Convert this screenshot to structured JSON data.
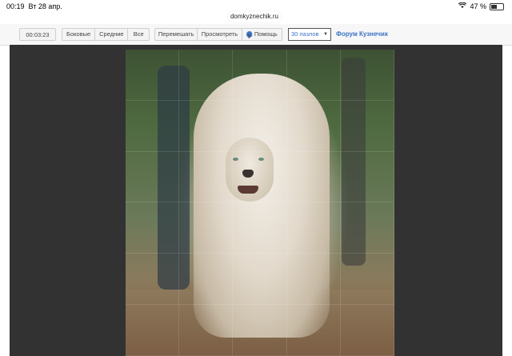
{
  "status_bar": {
    "time": "00:19",
    "date": "Вт 28 апр.",
    "battery_percent": "47 %",
    "battery_level": 0.47
  },
  "browser": {
    "url": "domkyznechik.ru"
  },
  "toolbar": {
    "timer": "00:03:23",
    "edge_buttons": [
      "Боковые",
      "Средние",
      "Все"
    ],
    "action_buttons": {
      "shuffle": "Перемешать",
      "preview": "Просмотреть",
      "help": "Помощь"
    },
    "pieces_select": {
      "value": "30 пазлов"
    },
    "forum_link": "Форум Кузнечик"
  },
  "puzzle": {
    "rows": 6,
    "cols": 5,
    "pieces": 30
  },
  "colors": {
    "accent": "#3b74c7",
    "stage_bg": "#323232"
  }
}
